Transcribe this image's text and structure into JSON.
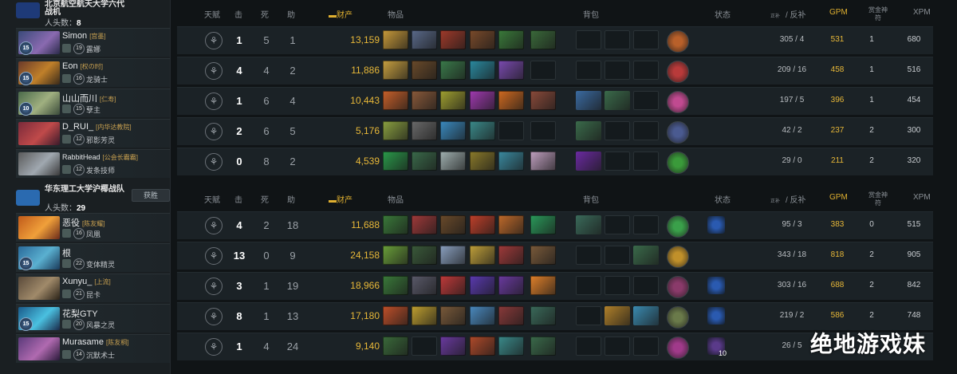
{
  "teams": [
    {
      "name": "北京航空航天大学六代战机",
      "kills_label": "人头数：",
      "kills": "8",
      "logo_color": "#1e3a78",
      "players": [
        {
          "name": "Simon",
          "tag": "[宫墨]",
          "hero_level": "19",
          "hero": "露娜",
          "rank": "15"
        },
        {
          "name": "Eon",
          "tag": "[权の时]",
          "hero_level": "16",
          "hero": "龙骑士",
          "rank": "15"
        },
        {
          "name": "山山而川",
          "tag": "[仁寿]",
          "hero_level": "15",
          "hero": "孽主",
          "rank": "10"
        },
        {
          "name": "D_RUI_",
          "tag": "[内华达教院]",
          "hero_level": "12",
          "hero": "邪影芳灵",
          "rank": ""
        },
        {
          "name": "RabbitHead",
          "tag": "[公会长霸霸]",
          "hero_level": "12",
          "hero": "发条技师",
          "rank": ""
        }
      ]
    },
    {
      "name": "华东理工大学沪椰战队",
      "kills_label": "人头数：",
      "kills": "29",
      "win_label": "获胜",
      "logo_color": "#2a6ab0",
      "players": [
        {
          "name": "恶役",
          "tag": "[陈友耀]",
          "hero_level": "16",
          "hero": "凤凰",
          "rank": ""
        },
        {
          "name": "根",
          "tag": "",
          "hero_level": "22",
          "hero": "变体精灵",
          "rank": "15"
        },
        {
          "name": "Xunyu_",
          "tag": "[上流]",
          "hero_level": "21",
          "hero": "昆卡",
          "rank": ""
        },
        {
          "name": "花梨GTY",
          "tag": "",
          "hero_level": "20",
          "hero": "风暴之灵",
          "rank": "15"
        },
        {
          "name": "Murasame",
          "tag": "[陈友桐]",
          "hero_level": "14",
          "hero": "沉默术士",
          "rank": ""
        }
      ]
    }
  ],
  "headers": {
    "talent": "天赋",
    "kills": "击",
    "deaths": "死",
    "assists": "助",
    "networth": "财产",
    "items": "物品",
    "backpack": "背包",
    "status": "状态",
    "cs_small": "正补",
    "cs": "/ 反补",
    "gpm": "GPM",
    "bounty": "赏金神符",
    "xpm": "XPM"
  },
  "stats": [
    [
      {
        "k": "1",
        "d": "5",
        "a": "1",
        "nw": "13,159",
        "cs": "305  /  4",
        "gpm": "531",
        "bounty": "1",
        "xpm": "680",
        "items": [
          "#c89a3a",
          "#5a6a8a",
          "#a03a2a",
          "#7a4a2a",
          "#3a7a3a",
          "#3a6a3a"
        ],
        "bp": [
          "",
          "",
          ""
        ],
        "neutral": "#b8602a",
        "status": ""
      },
      {
        "k": "4",
        "d": "4",
        "a": "2",
        "nw": "11,886",
        "cs": "209  /  16",
        "gpm": "458",
        "bounty": "1",
        "xpm": "516",
        "items": [
          "#c8a040",
          "#6a4a2a",
          "#3a7a4a",
          "#2a8aa0",
          "#7a4ab0",
          ""
        ],
        "bp": [
          "",
          "",
          ""
        ],
        "neutral": "#b83a3a",
        "status": ""
      },
      {
        "k": "1",
        "d": "6",
        "a": "4",
        "nw": "10,443",
        "cs": "197  /  5",
        "gpm": "396",
        "bounty": "1",
        "xpm": "454",
        "items": [
          "#c8602a",
          "#8a5a3a",
          "#a0a030",
          "#a03ab0",
          "#d06a20",
          "#8a4a3a"
        ],
        "bp": [
          "#3a6aa0",
          "#3a6a4a",
          ""
        ],
        "neutral": "#c04a90",
        "status": ""
      },
      {
        "k": "2",
        "d": "6",
        "a": "5",
        "nw": "5,176",
        "cs": "42  /  2",
        "gpm": "237",
        "bounty": "2",
        "xpm": "300",
        "items": [
          "#8aa040",
          "#6a6a6a",
          "#3a8ac0",
          "#3a8a8a",
          "",
          ""
        ],
        "bp": [
          "#3a6a4a",
          "",
          ""
        ],
        "neutral": "#4a5a90",
        "status": ""
      },
      {
        "k": "0",
        "d": "8",
        "a": "2",
        "nw": "4,539",
        "cs": "29  /  0",
        "gpm": "211",
        "bounty": "2",
        "xpm": "320",
        "items": [
          "#2a9a4a",
          "#3a6a4a",
          "#a0b0b0",
          "#8a7a2a",
          "#3a8aa0",
          "#c0a0c0"
        ],
        "bp": [
          "#6a2aa0",
          "",
          ""
        ],
        "neutral": "#3a9a3a",
        "status": ""
      }
    ],
    [
      {
        "k": "4",
        "d": "2",
        "a": "18",
        "nw": "11,688",
        "cs": "95  /  3",
        "gpm": "383",
        "bounty": "0",
        "xpm": "515",
        "items": [
          "#3a7a3a",
          "#a03a3a",
          "#6a4a2a",
          "#c0402a",
          "#c06a2a",
          "#2a9a5a"
        ],
        "bp": [
          "#3a6a5a",
          "",
          ""
        ],
        "neutral": "#3aa04a",
        "status": "#2a5ab0"
      },
      {
        "k": "13",
        "d": "0",
        "a": "9",
        "nw": "24,158",
        "cs": "343  /  18",
        "gpm": "818",
        "bounty": "2",
        "xpm": "905",
        "items": [
          "#6aa03a",
          "#3a5a3a",
          "#8aa0c0",
          "#c0a03a",
          "#a03a3a",
          "#7a5a3a"
        ],
        "bp": [
          "",
          "",
          "#3a6a4a"
        ],
        "neutral": "#c0902a",
        "status": ""
      },
      {
        "k": "3",
        "d": "1",
        "a": "19",
        "nw": "18,966",
        "cs": "303  /  16",
        "gpm": "688",
        "bounty": "2",
        "xpm": "842",
        "items": [
          "#3a7a3a",
          "#5a5a6a",
          "#c03a3a",
          "#5a3ab0",
          "#6a3aa0",
          "#e0802a"
        ],
        "bp": [
          "",
          "",
          ""
        ],
        "neutral": "#8a3a6a",
        "status": "#2a5ab0"
      },
      {
        "k": "8",
        "d": "1",
        "a": "13",
        "nw": "17,180",
        "cs": "219  /  2",
        "gpm": "586",
        "bounty": "2",
        "xpm": "748",
        "items": [
          "#c0502a",
          "#c0a030",
          "#7a5a3a",
          "#4a8ac0",
          "#8a3a3a",
          "#3a6a5a"
        ],
        "bp": [
          "",
          "#b0802a",
          "#3a8ab0"
        ],
        "neutral": "#6a7a4a",
        "status": "#2a5ab0"
      },
      {
        "k": "1",
        "d": "4",
        "a": "24",
        "nw": "9,140",
        "cs": "26  /  5",
        "gpm": "",
        "bounty": "",
        "xpm": "",
        "items": [
          "#3a6a3a",
          "",
          "#6a3aa0",
          "#b04a2a",
          "#3a8a8a",
          "#3a6a4a"
        ],
        "bp": [
          "",
          "",
          ""
        ],
        "neutral": "#a03a8a",
        "status": "#5a3a8a",
        "status_count": "10"
      }
    ]
  ],
  "watermark": "绝地游戏妹"
}
